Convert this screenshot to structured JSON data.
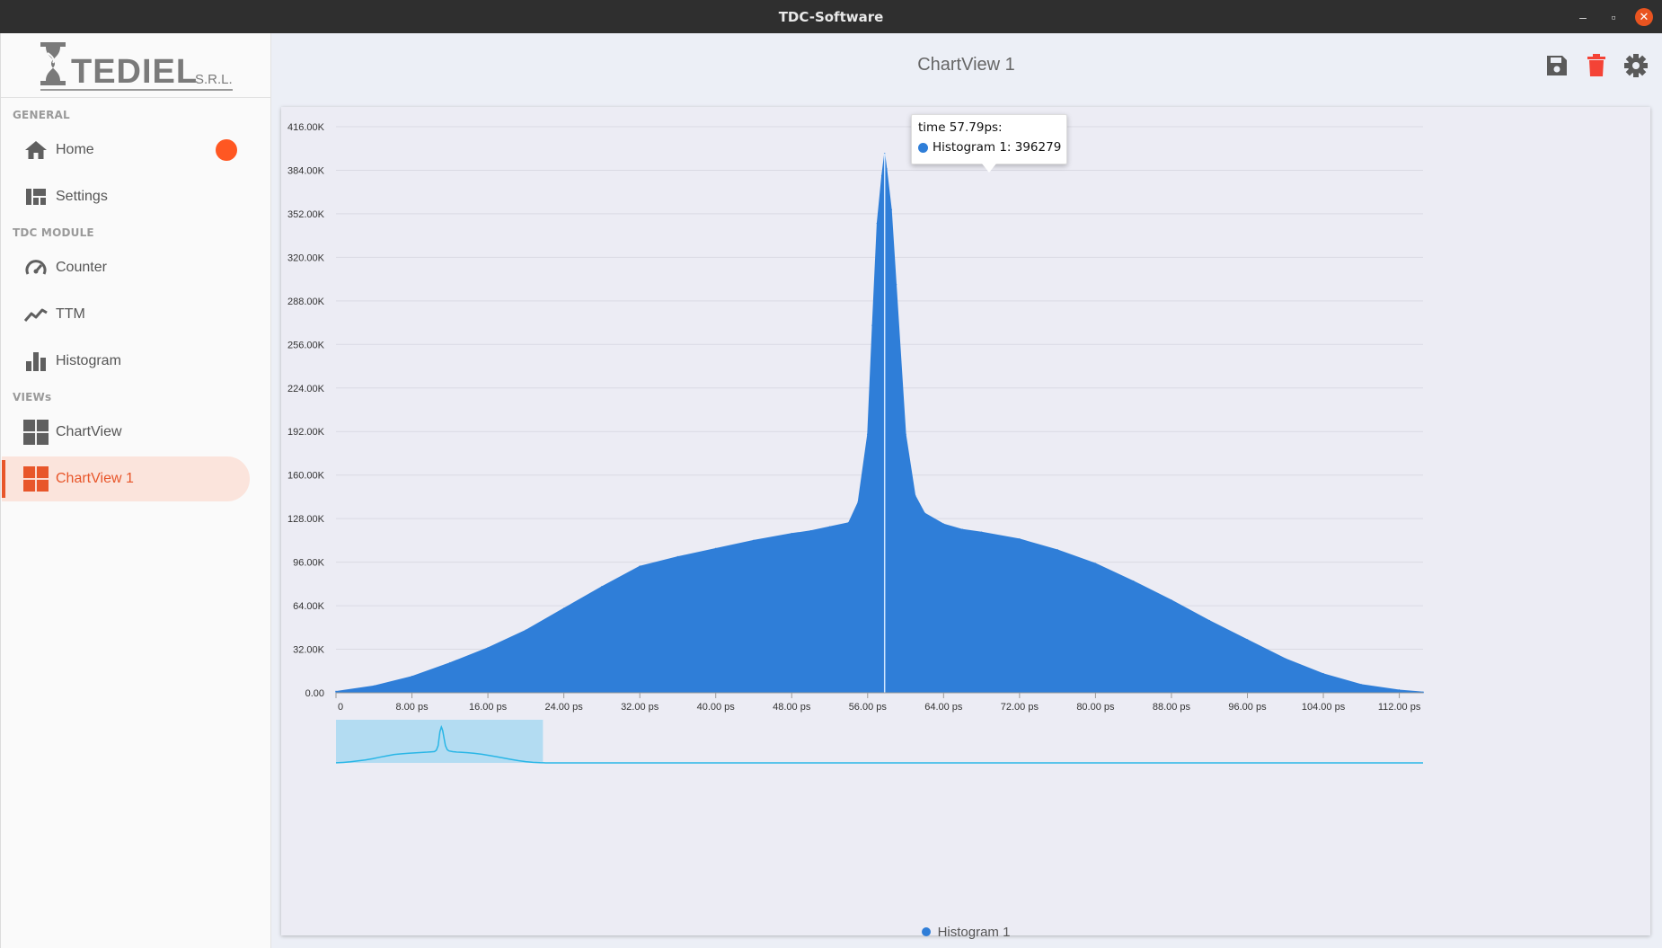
{
  "window": {
    "title": "TDC-Software"
  },
  "brand": {
    "name": "TEDIEL",
    "suffix": "S.R.L."
  },
  "sidebar": {
    "sections": [
      {
        "label": "GENERAL",
        "items": [
          {
            "label": "Home",
            "icon": "home-icon",
            "badge": true
          },
          {
            "label": "Settings",
            "icon": "settings-dashboard-icon"
          }
        ]
      },
      {
        "label": "TDC MODULE",
        "items": [
          {
            "label": "Counter",
            "icon": "speedometer-icon"
          },
          {
            "label": "TTM",
            "icon": "trend-line-icon"
          },
          {
            "label": "Histogram",
            "icon": "bar-chart-icon"
          }
        ]
      },
      {
        "label": "VIEWs",
        "items": [
          {
            "label": "ChartView",
            "icon": "grid-icon"
          },
          {
            "label": "ChartView 1",
            "icon": "grid-icon",
            "active": true
          }
        ]
      }
    ]
  },
  "header": {
    "title": "ChartView 1"
  },
  "colors": {
    "accent": "#e8562a",
    "series": "#2f7ed8",
    "navigator": "#29b6e6",
    "delete": "#f44336"
  },
  "tooltip": {
    "title": "time 57.79ps:",
    "series_label": "Histogram 1: 396279"
  },
  "legend": {
    "label": "Histogram 1"
  },
  "chart_data": {
    "type": "area",
    "title": "",
    "xlabel": "",
    "ylabel": "",
    "xlim": [
      0,
      114.5
    ],
    "ylim": [
      0,
      416000
    ],
    "y_ticks": [
      0,
      32000,
      64000,
      96000,
      128000,
      160000,
      192000,
      224000,
      256000,
      288000,
      320000,
      352000,
      384000,
      416000
    ],
    "y_tick_labels": [
      "0.00",
      "32.00K",
      "64.00K",
      "96.00K",
      "128.00K",
      "160.00K",
      "192.00K",
      "224.00K",
      "256.00K",
      "288.00K",
      "320.00K",
      "352.00K",
      "384.00K",
      "416.00K"
    ],
    "x_ticks": [
      0,
      8,
      16,
      24,
      32,
      40,
      48,
      56,
      64,
      72,
      80,
      88,
      96,
      104,
      112
    ],
    "x_tick_labels": [
      "0",
      "8.00 ps",
      "16.00 ps",
      "24.00 ps",
      "32.00 ps",
      "40.00 ps",
      "48.00 ps",
      "56.00 ps",
      "64.00 ps",
      "72.00 ps",
      "80.00 ps",
      "88.00 ps",
      "96.00 ps",
      "104.00 ps",
      "112.00 ps"
    ],
    "grid": true,
    "legend_position": "bottom-center",
    "series": [
      {
        "name": "Histogram 1",
        "x": [
          0,
          4,
          8,
          12,
          16,
          20,
          24,
          28,
          32,
          36,
          40,
          44,
          48,
          50,
          52,
          54,
          55,
          56,
          56.5,
          57,
          57.5,
          57.79,
          58,
          58.5,
          59,
          60,
          61,
          62,
          64,
          66,
          68,
          72,
          76,
          80,
          84,
          88,
          92,
          96,
          100,
          104,
          108,
          112,
          114.5
        ],
        "y": [
          1000,
          5000,
          12000,
          22000,
          33000,
          46000,
          62000,
          78000,
          93000,
          100000,
          106000,
          112000,
          117000,
          119000,
          122000,
          125000,
          140000,
          190000,
          270000,
          345000,
          380000,
          396279,
          385000,
          355000,
          300000,
          190000,
          145000,
          132000,
          124000,
          120000,
          118000,
          113000,
          105000,
          95000,
          82000,
          68000,
          53000,
          39000,
          25000,
          14000,
          6000,
          2000,
          500
        ]
      }
    ],
    "tooltip_point": {
      "x": 57.79,
      "y": 396279
    },
    "navigator": {
      "range": [
        0,
        21.8
      ]
    }
  }
}
